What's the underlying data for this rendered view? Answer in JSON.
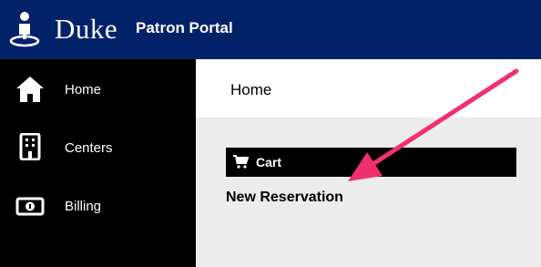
{
  "header": {
    "brand_word": "Duke",
    "portal_title": "Patron Portal",
    "background_color": "#012169"
  },
  "sidebar": {
    "items": [
      {
        "label": "Home",
        "icon": "home-icon"
      },
      {
        "label": "Centers",
        "icon": "building-icon"
      },
      {
        "label": "Billing",
        "icon": "money-bill-icon"
      }
    ]
  },
  "main": {
    "page_title": "Home",
    "cart": {
      "label": "Cart",
      "icon": "shopping-cart-icon"
    },
    "new_reservation_label": "New Reservation"
  },
  "annotation": {
    "type": "arrow",
    "color": "#f0306e"
  }
}
